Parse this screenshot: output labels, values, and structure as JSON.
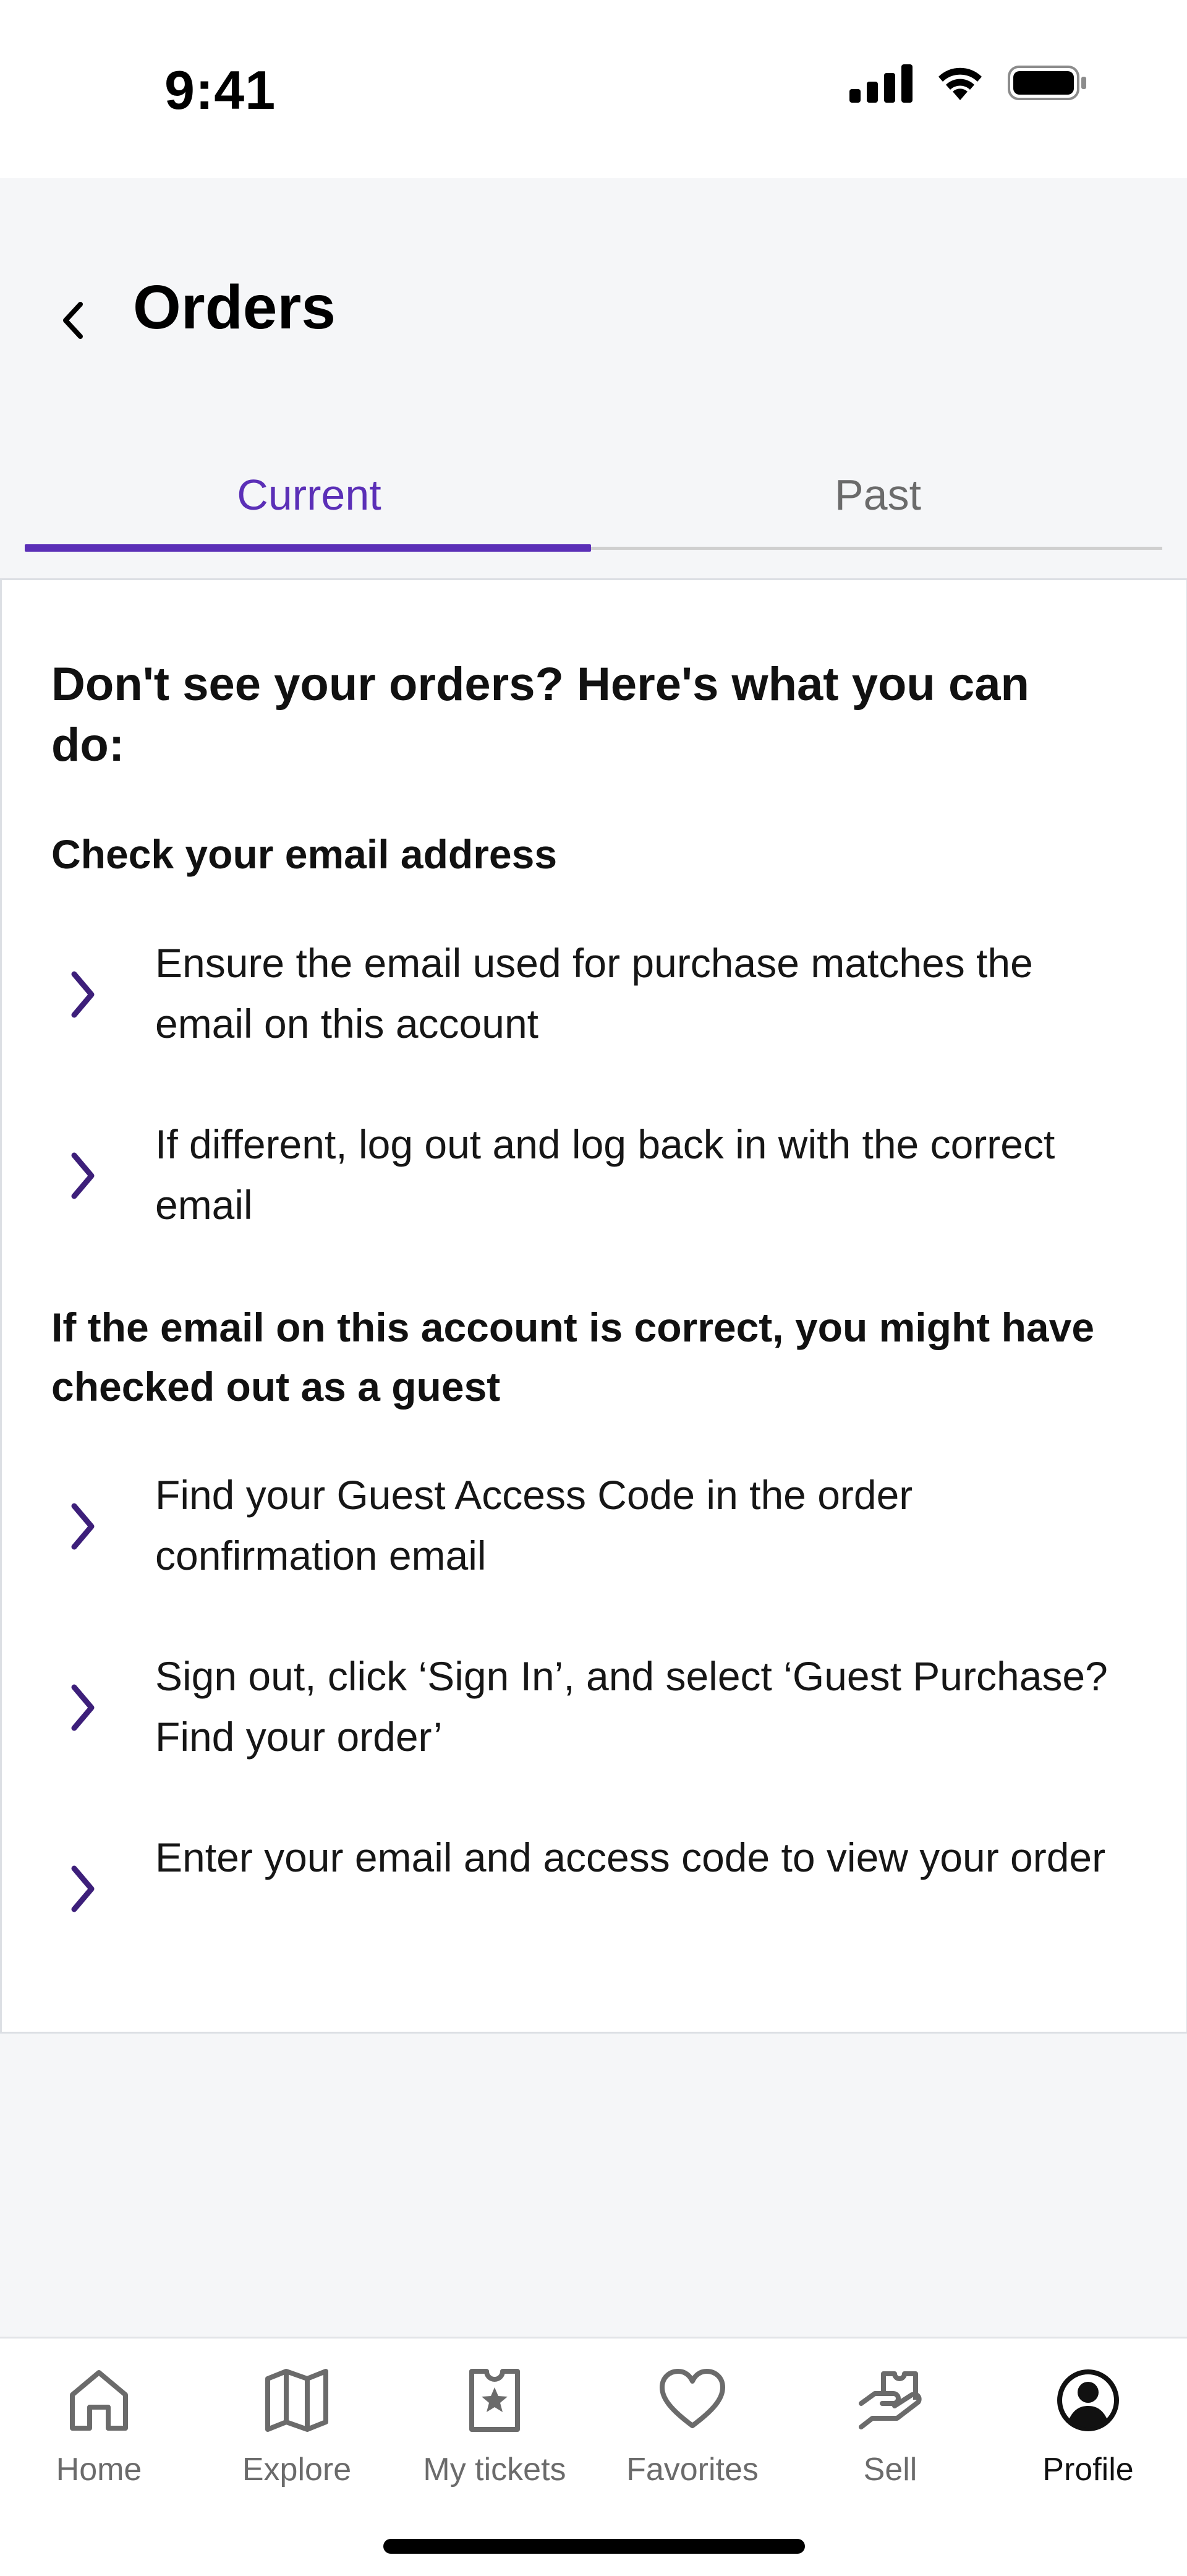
{
  "status_bar": {
    "time": "9:41"
  },
  "header": {
    "title": "Orders"
  },
  "tabs": [
    {
      "label": "Current",
      "active": true
    },
    {
      "label": "Past",
      "active": false
    }
  ],
  "card": {
    "heading": "Don't see your orders? Here's what you can do:",
    "sections": [
      {
        "title": "Check your email address",
        "items": [
          "Ensure the email used for purchase matches the email on this account",
          "If different, log out and log back in with the correct email"
        ]
      },
      {
        "title": "If the email on this account is correct, you might have checked out as a guest",
        "items": [
          "Find your Guest Access Code in the order confirmation email",
          "Sign out, click ‘Sign In’, and select ‘Guest Purchase? Find your order’",
          "Enter your email and access code to view your order"
        ]
      }
    ]
  },
  "bottom_nav": [
    {
      "label": "Home",
      "icon": "home-icon"
    },
    {
      "label": "Explore",
      "icon": "map-icon"
    },
    {
      "label": "My tickets",
      "icon": "ticket-icon"
    },
    {
      "label": "Favorites",
      "icon": "heart-icon"
    },
    {
      "label": "Sell",
      "icon": "sell-icon"
    },
    {
      "label": "Profile",
      "icon": "profile-icon",
      "active": true
    }
  ],
  "colors": {
    "accent": "#5b2fb7",
    "chevron": "#3d1f7a",
    "background": "#f5f6f8"
  }
}
